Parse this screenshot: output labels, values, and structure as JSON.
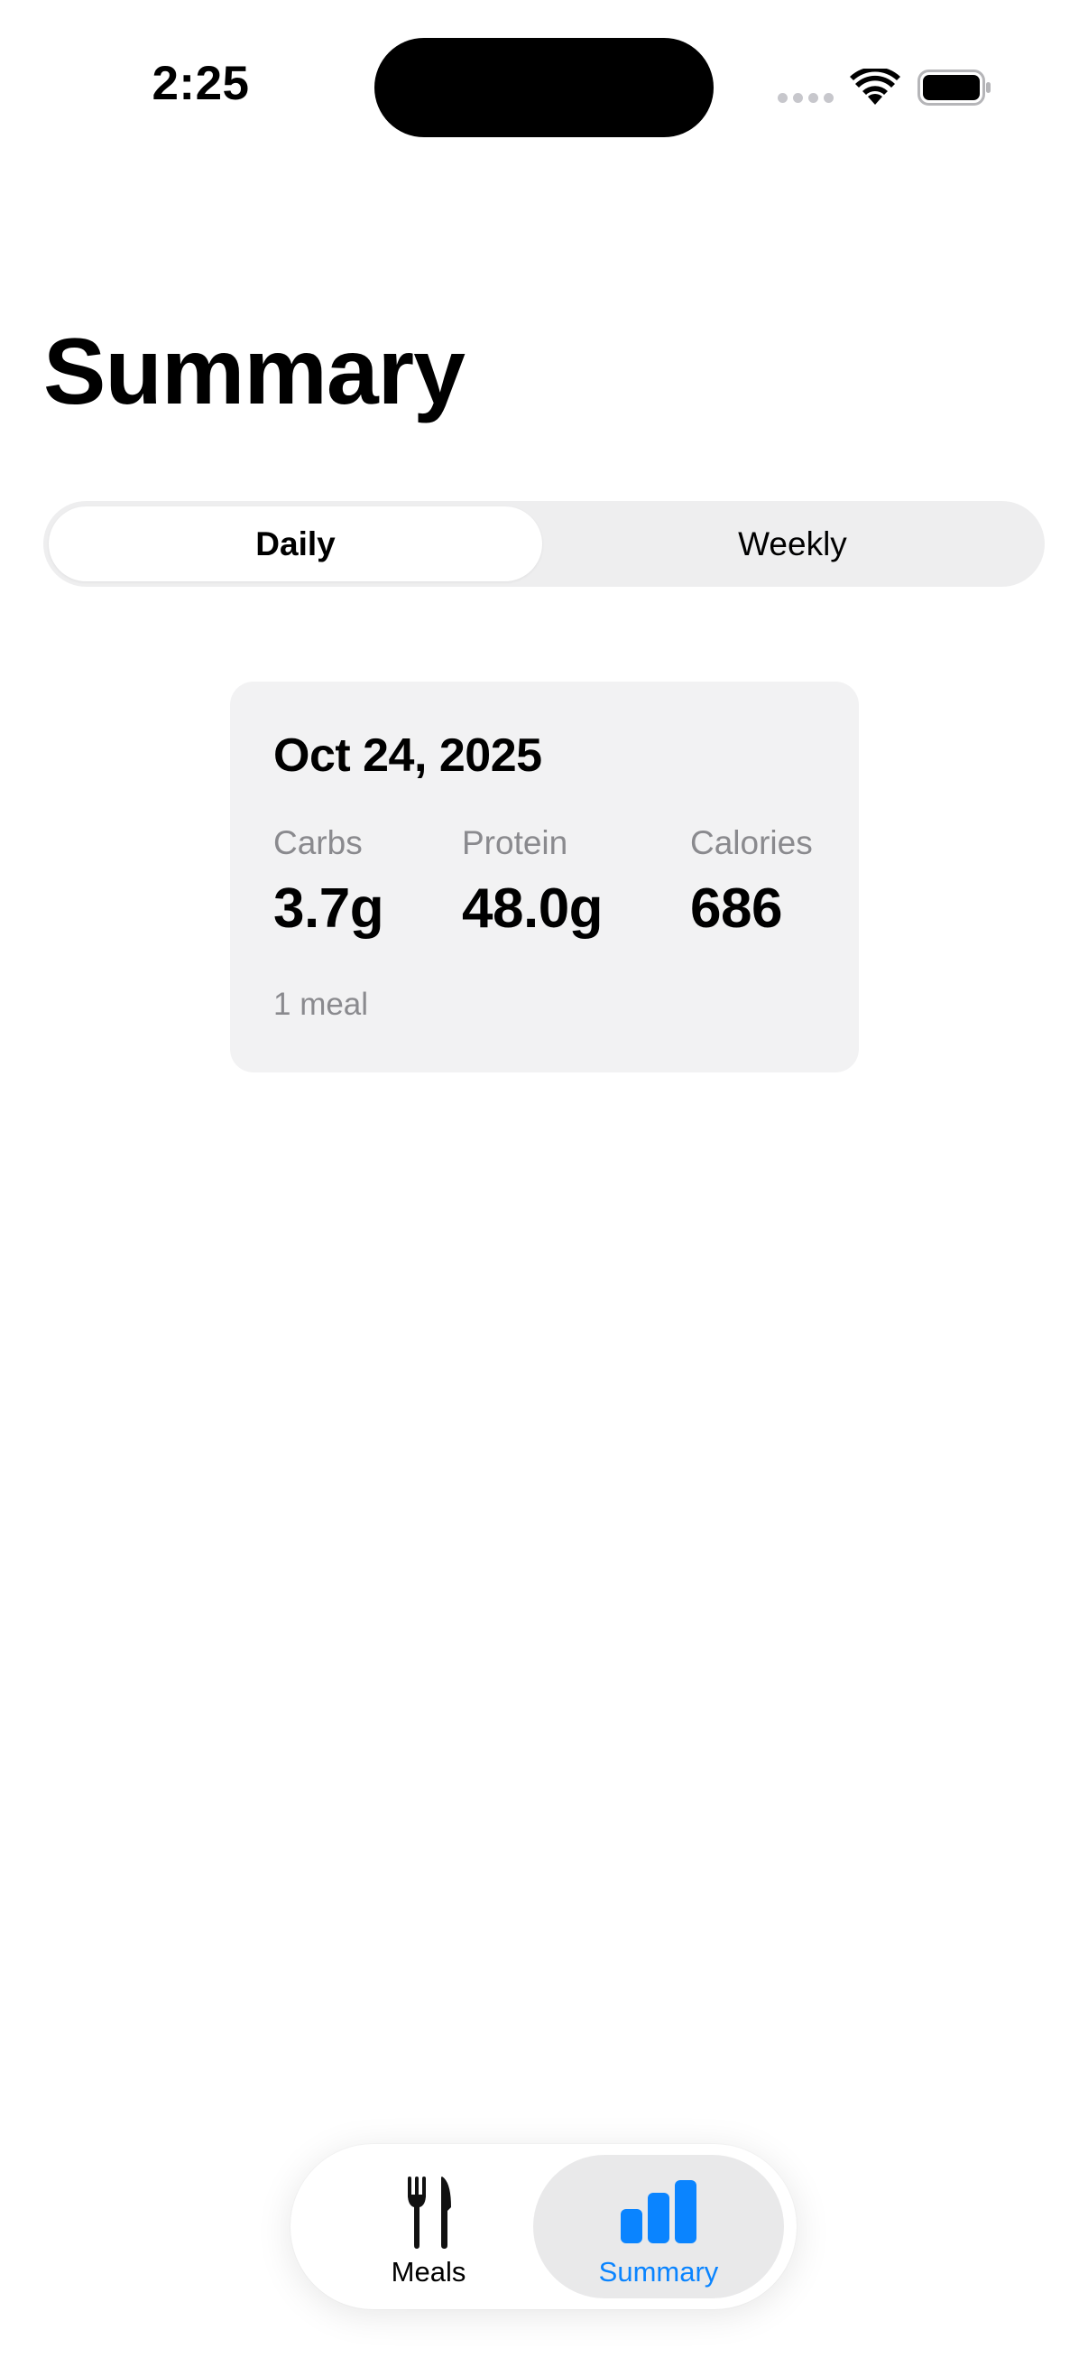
{
  "status_bar": {
    "time": "2:25",
    "icons": [
      "cellular-signal-icon",
      "wifi-icon",
      "battery-icon"
    ]
  },
  "page": {
    "title": "Summary"
  },
  "segmented_control": {
    "options": [
      "Daily",
      "Weekly"
    ],
    "selected": "Daily"
  },
  "summary_card": {
    "date": "Oct 24, 2025",
    "metrics": [
      {
        "label": "Carbs",
        "value": "3.7g"
      },
      {
        "label": "Protein",
        "value": "48.0g"
      },
      {
        "label": "Calories",
        "value": "686"
      }
    ],
    "footer": "1 meal"
  },
  "tab_bar": {
    "tabs": [
      {
        "label": "Meals",
        "icon": "fork-knife-icon",
        "selected": false
      },
      {
        "label": "Summary",
        "icon": "bar-chart-icon",
        "selected": true
      }
    ]
  },
  "colors": {
    "accent": "#0a84ff",
    "card_background": "#f2f2f3",
    "secondary_text": "#8a8a8e"
  }
}
